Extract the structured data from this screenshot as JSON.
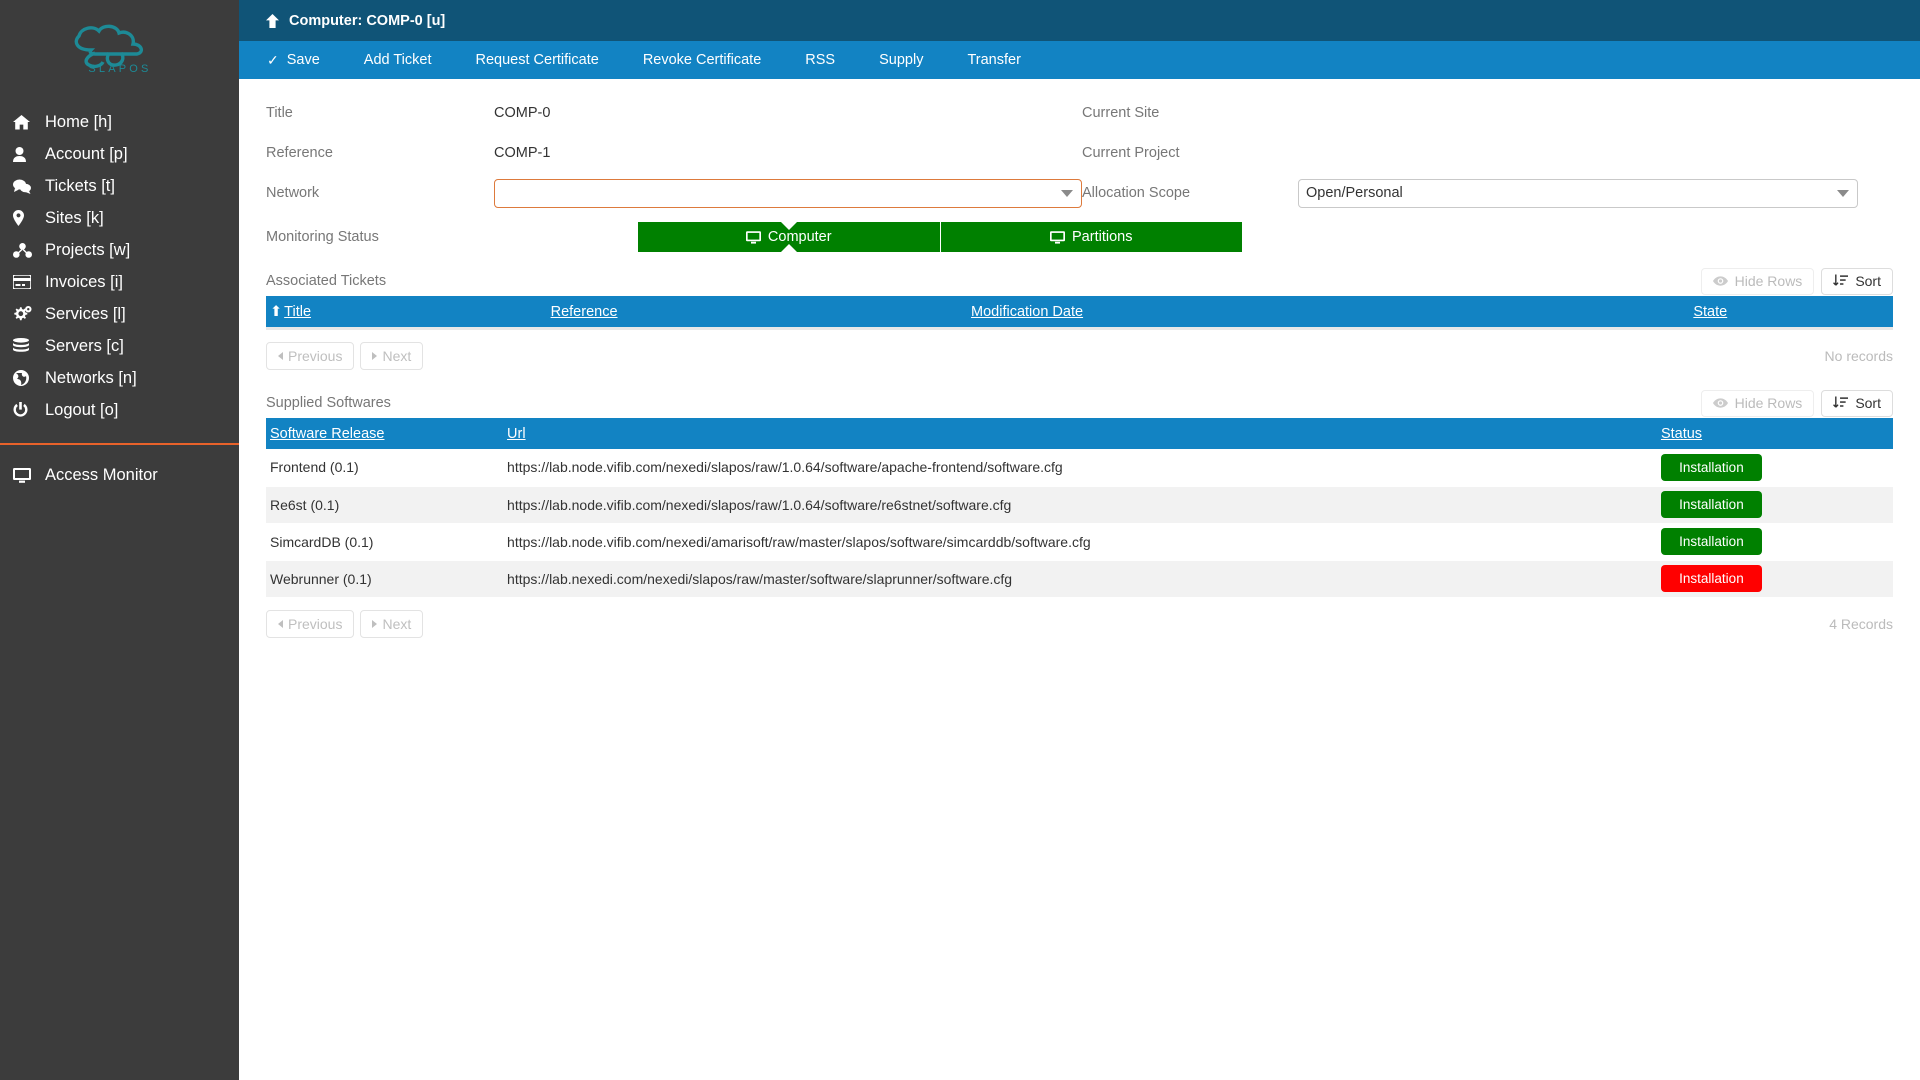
{
  "sidebar": {
    "logo_text": "SLAPOS",
    "items": [
      {
        "icon": "home-icon",
        "label": "Home [h]"
      },
      {
        "icon": "user-icon",
        "label": "Account [p]"
      },
      {
        "icon": "comments-icon",
        "label": "Tickets [t]"
      },
      {
        "icon": "map-marker-icon",
        "label": "Sites [k]"
      },
      {
        "icon": "project-icon",
        "label": "Projects [w]"
      },
      {
        "icon": "credit-card-icon",
        "label": "Invoices [i]"
      },
      {
        "icon": "cogs-icon",
        "label": "Services [l]"
      },
      {
        "icon": "database-icon",
        "label": "Servers [c]"
      },
      {
        "icon": "globe-icon",
        "label": "Networks [n]"
      },
      {
        "icon": "power-icon",
        "label": "Logout [o]"
      }
    ],
    "bottom_items": [
      {
        "icon": "monitor-icon",
        "label": "Access Monitor"
      }
    ]
  },
  "header": {
    "up_icon": "arrow-up-icon",
    "title": "Computer: COMP-0 [u]"
  },
  "toolbar": {
    "save_label": "Save",
    "save_icon": "check-icon",
    "items": [
      "Add Ticket",
      "Request Certificate",
      "Revoke Certificate",
      "RSS",
      "Supply",
      "Transfer"
    ]
  },
  "form": {
    "title_label": "Title",
    "title_value": "COMP-0",
    "reference_label": "Reference",
    "reference_value": "COMP-1",
    "network_label": "Network",
    "network_value": "",
    "monitoring_label": "Monitoring Status",
    "monitoring_buttons": [
      {
        "label": "Computer",
        "icon": "desktop-icon"
      },
      {
        "label": "Partitions",
        "icon": "desktop-icon"
      }
    ],
    "current_site_label": "Current Site",
    "current_site_value": "",
    "current_project_label": "Current Project",
    "current_project_value": "",
    "allocation_scope_label": "Allocation Scope",
    "allocation_scope_value": "Open/Personal"
  },
  "tickets": {
    "section_title": "Associated Tickets",
    "hide_rows_label": "Hide Rows",
    "hide_rows_icon": "eye-icon",
    "sort_label": "Sort",
    "sort_icon": "sort-icon",
    "columns": [
      "Title",
      "Reference",
      "Modification Date",
      "State"
    ],
    "sorted_column_marker": "arrow-up-icon",
    "rows": [],
    "previous_label": "Previous",
    "next_label": "Next",
    "records_label": "No records"
  },
  "softwares": {
    "section_title": "Supplied Softwares",
    "hide_rows_label": "Hide Rows",
    "hide_rows_icon": "eye-icon",
    "sort_label": "Sort",
    "sort_icon": "sort-icon",
    "columns": [
      "Software Release",
      "Url",
      "Status"
    ],
    "rows": [
      {
        "release": "Frontend (0.1)",
        "url": "https://lab.node.vifib.com/nexedi/slapos/raw/1.0.64/software/apache-frontend/software.cfg",
        "status": "Installation",
        "status_color": "#008000"
      },
      {
        "release": "Re6st (0.1)",
        "url": "https://lab.node.vifib.com/nexedi/slapos/raw/1.0.64/software/re6stnet/software.cfg",
        "status": "Installation",
        "status_color": "#008000"
      },
      {
        "release": "SimcardDB (0.1)",
        "url": "https://lab.node.vifib.com/nexedi/amarisoft/raw/master/slapos/software/simcarddb/software.cfg",
        "status": "Installation",
        "status_color": "#008000"
      },
      {
        "release": "Webrunner (0.1)",
        "url": "https://lab.nexedi.com/nexedi/slapos/raw/master/software/slaprunner/software.cfg",
        "status": "Installation",
        "status_color": "#ff0000"
      }
    ],
    "previous_label": "Previous",
    "next_label": "Next",
    "records_label": "4 Records"
  },
  "colors": {
    "sidebar_bg": "#3c3c3c",
    "titlebar_bg": "#105477",
    "toolbar_bg": "#1283c3",
    "accent_orange": "#e8622a",
    "table_header_bg": "#1283c3",
    "green": "#008000",
    "red": "#ff0000",
    "logo_teal": "#1d8a96"
  }
}
